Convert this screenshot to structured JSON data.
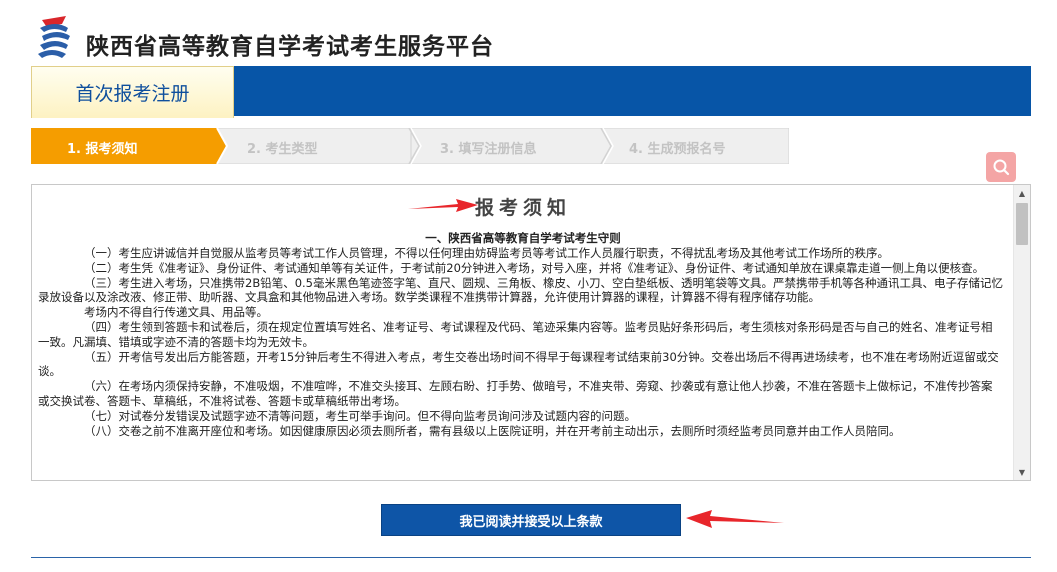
{
  "header": {
    "site_title": "陕西省高等教育自学考试考生服务平台",
    "logo_icon": "exam-logo-icon"
  },
  "tab": {
    "label": "首次报考注册"
  },
  "steps": [
    {
      "label": "1. 报考须知",
      "active": true
    },
    {
      "label": "2. 考生类型",
      "active": false
    },
    {
      "label": "3. 填写注册信息",
      "active": false
    },
    {
      "label": "4. 生成预报名号",
      "active": false
    }
  ],
  "notice": {
    "title": "报考须知",
    "rules_heading": "一、陕西省高等教育自学考试考生守则",
    "paragraphs": [
      "（一）考生应讲诚信并自觉服从监考员等考试工作人员管理，不得以任何理由妨碍监考员等考试工作人员履行职责，不得扰乱考场及其他考试工作场所的秩序。",
      "（二）考生凭《准考证》、身份证件、考试通知单等有关证件，于考试前20分钟进入考场，对号入座，并将《准考证》、身份证件、考试通知单放在课桌靠走道一侧上角以便核查。",
      "（三）考生进入考场，只准携带2B铅笔、0.5毫米黑色笔迹签字笔、直尺、圆规、三角板、橡皮、小刀、空白垫纸板、透明笔袋等文具。严禁携带手机等各种通讯工具、电子存储记忆录放设备以及涂改液、修正带、助听器、文具盒和其他物品进入考场。数学类课程不准携带计算器，允许使用计算器的课程，计算器不得有程序储存功能。",
      "考场内不得自行传递文具、用品等。",
      "（四）考生领到答题卡和试卷后，须在规定位置填写姓名、准考证号、考试课程及代码、笔迹采集内容等。监考员贴好条形码后，考生须核对条形码是否与自己的姓名、准考证号相一致。凡漏填、错填或字迹不清的答题卡均为无效卡。",
      "（五）开考信号发出后方能答题，开考15分钟后考生不得进入考点，考生交卷出场时间不得早于每课程考试结束前30分钟。交卷出场后不得再进场续考，也不准在考场附近逗留或交谈。",
      "（六）在考场内须保持安静，不准吸烟，不准喧哗，不准交头接耳、左顾右盼、打手势、做暗号，不准夹带、旁窥、抄袭或有意让他人抄袭，不准在答题卡上做标记，不准传抄答案或交换试卷、答题卡、草稿纸，不准将试卷、答题卡或草稿纸带出考场。",
      "（七）对试卷分发错误及试题字迹不清等问题，考生可举手询问。但不得向监考员询问涉及试题内容的问题。",
      "（八）交卷之前不准离开座位和考场。如因健康原因必须去厕所者，需有县级以上医院证明，并在开考前主动出示，去厕所时须经监考员同意并由工作人员陪同。"
    ]
  },
  "accept_button": {
    "label": "我已阅读并接受以上条款"
  },
  "colors": {
    "brand_blue": "#0755a7",
    "step_active": "#f59d00",
    "step_inactive": "#efefef",
    "arrow_red": "#e8262b",
    "search_pink": "#f4a5a5"
  }
}
